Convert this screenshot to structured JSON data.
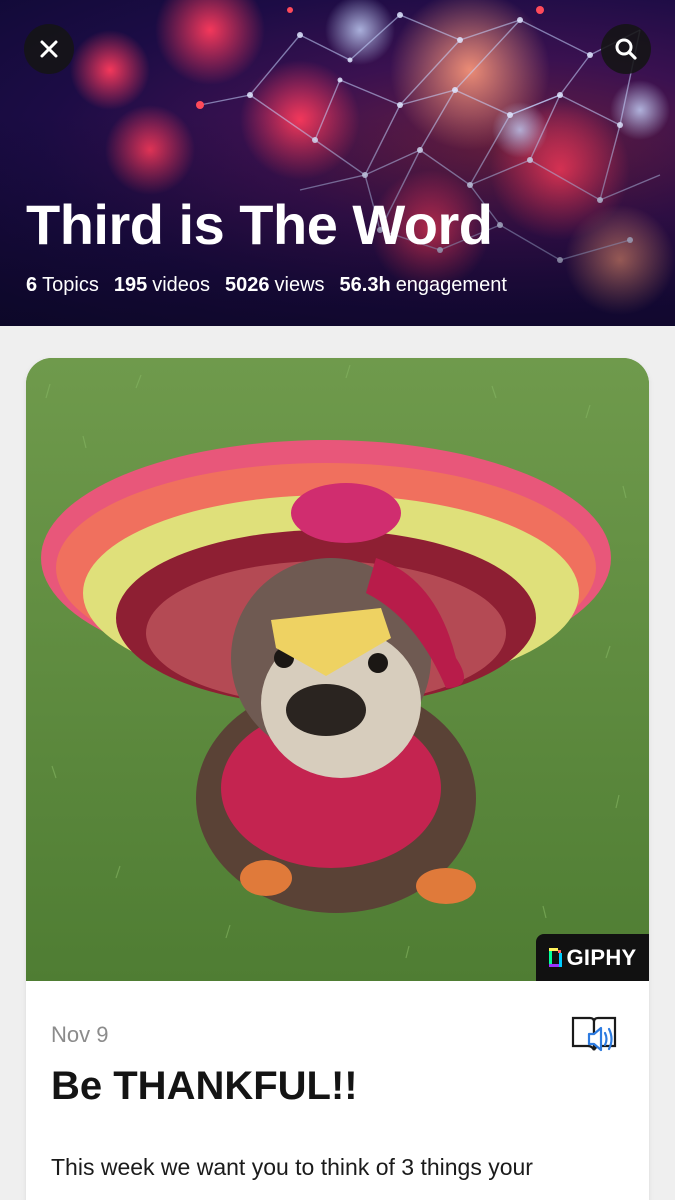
{
  "header": {
    "title": "Third is The Word",
    "stats": [
      {
        "value": "6",
        "label": "Topics"
      },
      {
        "value": "195",
        "label": "videos"
      },
      {
        "value": "5026",
        "label": "views"
      },
      {
        "value": "56.3h",
        "label": "engagement"
      }
    ],
    "close_icon": "close-icon",
    "search_icon": "search-icon"
  },
  "card": {
    "media_badge": "GIPHY",
    "date": "Nov 9",
    "title": "Be THANKFUL!!",
    "body": "This week we want you to think of 3 things your",
    "read_icon": "read-aloud-book-icon"
  },
  "colors": {
    "page_background": "#efefef",
    "header_accent": "#e0305a",
    "card_background": "#ffffff",
    "title_text": "#141414",
    "muted_text": "#8b8b8b",
    "icon_blue": "#2d7be0"
  }
}
